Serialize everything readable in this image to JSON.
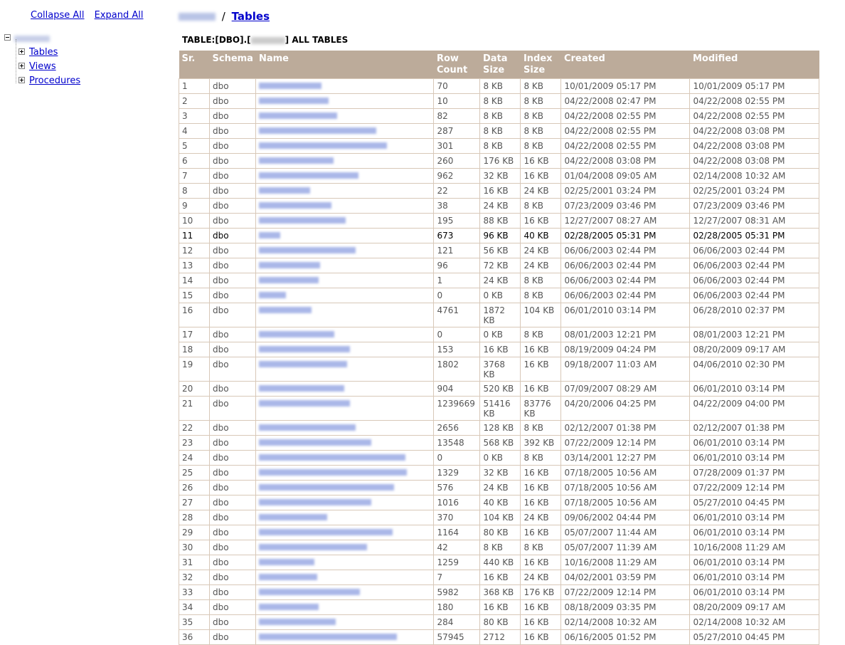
{
  "tree_controls": {
    "collapse_all": "Collapse All",
    "expand_all": "Expand All"
  },
  "tree": {
    "children": [
      "Tables",
      "Views",
      "Procedures"
    ]
  },
  "breadcrumb": {
    "separator": "/",
    "current": "Tables"
  },
  "title": {
    "prefix": "TABLE:[DBO].[",
    "suffix": "] ALL TABLES"
  },
  "columns": [
    "Sr.",
    "Schema",
    "Name",
    "Row Count",
    "Data Size",
    "Index Size",
    "Created",
    "Modified"
  ],
  "rows": [
    {
      "sr": "1",
      "schema": "dbo",
      "rc": "70",
      "ds": "8 KB",
      "is": "8 KB",
      "created": "10/01/2009 05:17 PM",
      "modified": "10/01/2009 05:17 PM"
    },
    {
      "sr": "2",
      "schema": "dbo",
      "rc": "10",
      "ds": "8 KB",
      "is": "8 KB",
      "created": "04/22/2008 02:47 PM",
      "modified": "04/22/2008 02:55 PM"
    },
    {
      "sr": "3",
      "schema": "dbo",
      "rc": "82",
      "ds": "8 KB",
      "is": "8 KB",
      "created": "04/22/2008 02:55 PM",
      "modified": "04/22/2008 02:55 PM"
    },
    {
      "sr": "4",
      "schema": "dbo",
      "rc": "287",
      "ds": "8 KB",
      "is": "8 KB",
      "created": "04/22/2008 02:55 PM",
      "modified": "04/22/2008 03:08 PM"
    },
    {
      "sr": "5",
      "schema": "dbo",
      "rc": "301",
      "ds": "8 KB",
      "is": "8 KB",
      "created": "04/22/2008 02:55 PM",
      "modified": "04/22/2008 03:08 PM"
    },
    {
      "sr": "6",
      "schema": "dbo",
      "rc": "260",
      "ds": "176 KB",
      "is": "16 KB",
      "created": "04/22/2008 03:08 PM",
      "modified": "04/22/2008 03:08 PM"
    },
    {
      "sr": "7",
      "schema": "dbo",
      "rc": "962",
      "ds": "32 KB",
      "is": "16 KB",
      "created": "01/04/2008 09:05 AM",
      "modified": "02/14/2008 10:32 AM"
    },
    {
      "sr": "8",
      "schema": "dbo",
      "rc": "22",
      "ds": "16 KB",
      "is": "24 KB",
      "created": "02/25/2001 03:24 PM",
      "modified": "02/25/2001 03:24 PM"
    },
    {
      "sr": "9",
      "schema": "dbo",
      "rc": "38",
      "ds": "24 KB",
      "is": "8 KB",
      "created": "07/23/2009 03:46 PM",
      "modified": "07/23/2009 03:46 PM"
    },
    {
      "sr": "10",
      "schema": "dbo",
      "rc": "195",
      "ds": "88 KB",
      "is": "16 KB",
      "created": "12/27/2007 08:27 AM",
      "modified": "12/27/2007 08:31 AM"
    },
    {
      "sr": "11",
      "schema": "dbo",
      "rc": "673",
      "ds": "96 KB",
      "is": "40 KB",
      "created": "02/28/2005 05:31 PM",
      "modified": "02/28/2005 05:31 PM",
      "highlight": true
    },
    {
      "sr": "12",
      "schema": "dbo",
      "rc": "121",
      "ds": "56 KB",
      "is": "24 KB",
      "created": "06/06/2003 02:44 PM",
      "modified": "06/06/2003 02:44 PM"
    },
    {
      "sr": "13",
      "schema": "dbo",
      "rc": "96",
      "ds": "72 KB",
      "is": "24 KB",
      "created": "06/06/2003 02:44 PM",
      "modified": "06/06/2003 02:44 PM"
    },
    {
      "sr": "14",
      "schema": "dbo",
      "rc": "1",
      "ds": "24 KB",
      "is": "8 KB",
      "created": "06/06/2003 02:44 PM",
      "modified": "06/06/2003 02:44 PM"
    },
    {
      "sr": "15",
      "schema": "dbo",
      "rc": "0",
      "ds": "0 KB",
      "is": "8 KB",
      "created": "06/06/2003 02:44 PM",
      "modified": "06/06/2003 02:44 PM"
    },
    {
      "sr": "16",
      "schema": "dbo",
      "rc": "4761",
      "ds": "1872 KB",
      "is": "104 KB",
      "created": "06/01/2010 03:14 PM",
      "modified": "06/28/2010 02:37 PM"
    },
    {
      "sr": "17",
      "schema": "dbo",
      "rc": "0",
      "ds": "0 KB",
      "is": "8 KB",
      "created": "08/01/2003 12:21 PM",
      "modified": "08/01/2003 12:21 PM"
    },
    {
      "sr": "18",
      "schema": "dbo",
      "rc": "153",
      "ds": "16 KB",
      "is": "16 KB",
      "created": "08/19/2009 04:24 PM",
      "modified": "08/20/2009 09:17 AM"
    },
    {
      "sr": "19",
      "schema": "dbo",
      "rc": "1802",
      "ds": "3768 KB",
      "is": "16 KB",
      "created": "09/18/2007 11:03 AM",
      "modified": "04/06/2010 02:30 PM"
    },
    {
      "sr": "20",
      "schema": "dbo",
      "rc": "904",
      "ds": "520 KB",
      "is": "16 KB",
      "created": "07/09/2007 08:29 AM",
      "modified": "06/01/2010 03:14 PM"
    },
    {
      "sr": "21",
      "schema": "dbo",
      "rc": "1239669",
      "ds": "51416 KB",
      "is": "83776 KB",
      "created": "04/20/2006 04:25 PM",
      "modified": "04/22/2009 04:00 PM"
    },
    {
      "sr": "22",
      "schema": "dbo",
      "rc": "2656",
      "ds": "128 KB",
      "is": "8 KB",
      "created": "02/12/2007 01:38 PM",
      "modified": "02/12/2007 01:38 PM"
    },
    {
      "sr": "23",
      "schema": "dbo",
      "rc": "13548",
      "ds": "568 KB",
      "is": "392 KB",
      "created": "07/22/2009 12:14 PM",
      "modified": "06/01/2010 03:14 PM"
    },
    {
      "sr": "24",
      "schema": "dbo",
      "rc": "0",
      "ds": "0 KB",
      "is": "8 KB",
      "created": "03/14/2001 12:27 PM",
      "modified": "06/01/2010 03:14 PM"
    },
    {
      "sr": "25",
      "schema": "dbo",
      "rc": "1329",
      "ds": "32 KB",
      "is": "16 KB",
      "created": "07/18/2005 10:56 AM",
      "modified": "07/28/2009 01:37 PM"
    },
    {
      "sr": "26",
      "schema": "dbo",
      "rc": "576",
      "ds": "24 KB",
      "is": "16 KB",
      "created": "07/18/2005 10:56 AM",
      "modified": "07/22/2009 12:14 PM"
    },
    {
      "sr": "27",
      "schema": "dbo",
      "rc": "1016",
      "ds": "40 KB",
      "is": "16 KB",
      "created": "07/18/2005 10:56 AM",
      "modified": "05/27/2010 04:45 PM"
    },
    {
      "sr": "28",
      "schema": "dbo",
      "rc": "370",
      "ds": "104 KB",
      "is": "24 KB",
      "created": "09/06/2002 04:44 PM",
      "modified": "06/01/2010 03:14 PM"
    },
    {
      "sr": "29",
      "schema": "dbo",
      "rc": "1164",
      "ds": "80 KB",
      "is": "16 KB",
      "created": "05/07/2007 11:44 AM",
      "modified": "06/01/2010 03:14 PM"
    },
    {
      "sr": "30",
      "schema": "dbo",
      "rc": "42",
      "ds": "8 KB",
      "is": "8 KB",
      "created": "05/07/2007 11:39 AM",
      "modified": "10/16/2008 11:29 AM"
    },
    {
      "sr": "31",
      "schema": "dbo",
      "rc": "1259",
      "ds": "440 KB",
      "is": "16 KB",
      "created": "10/16/2008 11:29 AM",
      "modified": "06/01/2010 03:14 PM"
    },
    {
      "sr": "32",
      "schema": "dbo",
      "rc": "7",
      "ds": "16 KB",
      "is": "24 KB",
      "created": "04/02/2001 03:59 PM",
      "modified": "06/01/2010 03:14 PM"
    },
    {
      "sr": "33",
      "schema": "dbo",
      "rc": "5982",
      "ds": "368 KB",
      "is": "176 KB",
      "created": "07/22/2009 12:14 PM",
      "modified": "06/01/2010 03:14 PM"
    },
    {
      "sr": "34",
      "schema": "dbo",
      "rc": "180",
      "ds": "16 KB",
      "is": "16 KB",
      "created": "08/18/2009 03:35 PM",
      "modified": "08/20/2009 09:17 AM"
    },
    {
      "sr": "35",
      "schema": "dbo",
      "rc": "284",
      "ds": "80 KB",
      "is": "16 KB",
      "created": "02/14/2008 10:32 AM",
      "modified": "02/14/2008 10:32 AM"
    },
    {
      "sr": "36",
      "schema": "dbo",
      "rc": "57945",
      "ds": "2712",
      "is": "16 KB",
      "created": "06/16/2005 01:52 PM",
      "modified": "05/27/2010 04:45 PM"
    }
  ]
}
